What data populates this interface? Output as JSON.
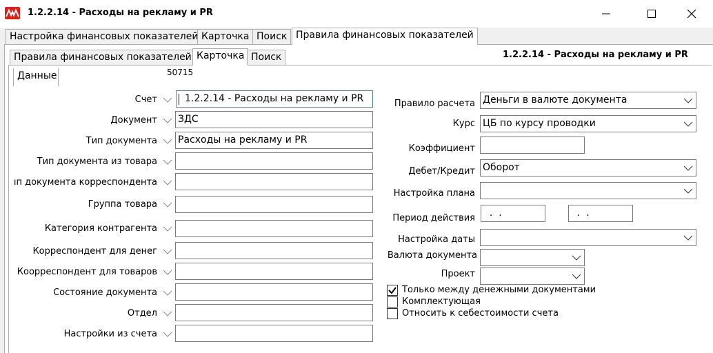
{
  "window": {
    "title": "1.2.2.14 - Расходы на рекламу и PR"
  },
  "top_tabs": [
    {
      "label": "Настройка финансовых показателей"
    },
    {
      "label": "Карточка"
    },
    {
      "label": "Поиск"
    },
    {
      "label": "Правила финансовых показателей"
    }
  ],
  "inner_tabs": [
    {
      "label": "Правила финансовых показателей"
    },
    {
      "label": "Карточка"
    },
    {
      "label": "Поиск"
    }
  ],
  "record": {
    "title": "1.2.2.14 - Расходы на рекламу и PR",
    "data_tab": "Данные",
    "id": "50715"
  },
  "left_form": {
    "schet": {
      "label": "Счет",
      "value": "1.2.2.14 - Расходы на рекламу и PR"
    },
    "dokument": {
      "label": "Документ",
      "value": "ЗДС"
    },
    "tip_dokumenta": {
      "label": "Тип документа",
      "value": "Расходы на рекламу и PR"
    },
    "tip_iz_tovara": {
      "label": "Тип документа из товара",
      "value": ""
    },
    "tip_korr": {
      "label": "ıп документа корреспондента",
      "value": ""
    },
    "gruppa_tovara": {
      "label": "Группа товара",
      "value": ""
    },
    "kategoriya": {
      "label": "Категория контрагента",
      "value": ""
    },
    "korr_deneg": {
      "label": "Корреспондент для денег",
      "value": ""
    },
    "korr_tovarov": {
      "label": "Коорреспондент для товаров",
      "value": ""
    },
    "sostoyanie": {
      "label": "Состояние документа",
      "value": ""
    },
    "otdel": {
      "label": "Отдел",
      "value": ""
    },
    "nastroiki": {
      "label": "Настройки из счета",
      "value": ""
    }
  },
  "right_form": {
    "pravilo": {
      "label": "Правило расчета",
      "value": "Деньги в валюте документа"
    },
    "kurs": {
      "label": "Курс",
      "value": "ЦБ по курсу проводки"
    },
    "koef": {
      "label": "Коэффициент",
      "value": ""
    },
    "debet": {
      "label": "Дебет/Кредит",
      "value": "Оборот"
    },
    "plan": {
      "label": "Настройка плана",
      "value": ""
    },
    "period": {
      "label": "Период действия",
      "from": "  .  .",
      "to": "  .  ."
    },
    "data": {
      "label": "Настройка даты",
      "value": ""
    },
    "valuta": {
      "label": "Валюта документа",
      "value": ""
    },
    "proekt": {
      "label": "Проект",
      "value": ""
    }
  },
  "checkboxes": [
    {
      "label": "Только между денежными документами",
      "checked": true
    },
    {
      "label": "Комплектующая",
      "checked": false
    },
    {
      "label": "Относить к себестоимости счета",
      "checked": false
    }
  ],
  "colors": {
    "app_icon": "#d9211c",
    "focus_border": "#4a7fc1"
  }
}
